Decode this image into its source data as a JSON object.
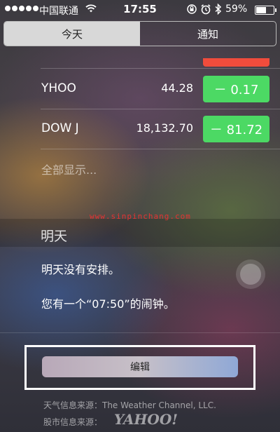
{
  "status_bar": {
    "carrier": "中国联通",
    "time": "17:55",
    "battery_percent": "59%",
    "battery_level": 0.59,
    "icons": [
      "wifi-icon",
      "orientation-lock-icon",
      "alarm-icon",
      "bluetooth-icon",
      "battery-icon"
    ]
  },
  "tabs": [
    {
      "label": "今天",
      "active": true
    },
    {
      "label": "通知",
      "active": false
    }
  ],
  "stocks": [
    {
      "symbol": "YHOO",
      "price": "44.28",
      "change": "－ 0.17"
    },
    {
      "symbol": "DOW J",
      "price": "18,132.70",
      "change": "－ 81.72"
    }
  ],
  "show_all_label": "全部显示...",
  "watermark": "www.sinpinchang.com",
  "tomorrow": {
    "header": "明天",
    "no_events": "明天没有安排。",
    "alarm_note": "您有一个“07:50”的闹钟。"
  },
  "edit_button_label": "编辑",
  "sources": {
    "weather": "天气信息来源：The Weather Channel, LLC.",
    "stock_prefix": "股市信息来源：",
    "stock_logo": "YAHOO!"
  },
  "colors": {
    "stock_up_green": "#4cd964",
    "stock_down_red": "#f04c3c",
    "watermark_red": "#e53333"
  }
}
